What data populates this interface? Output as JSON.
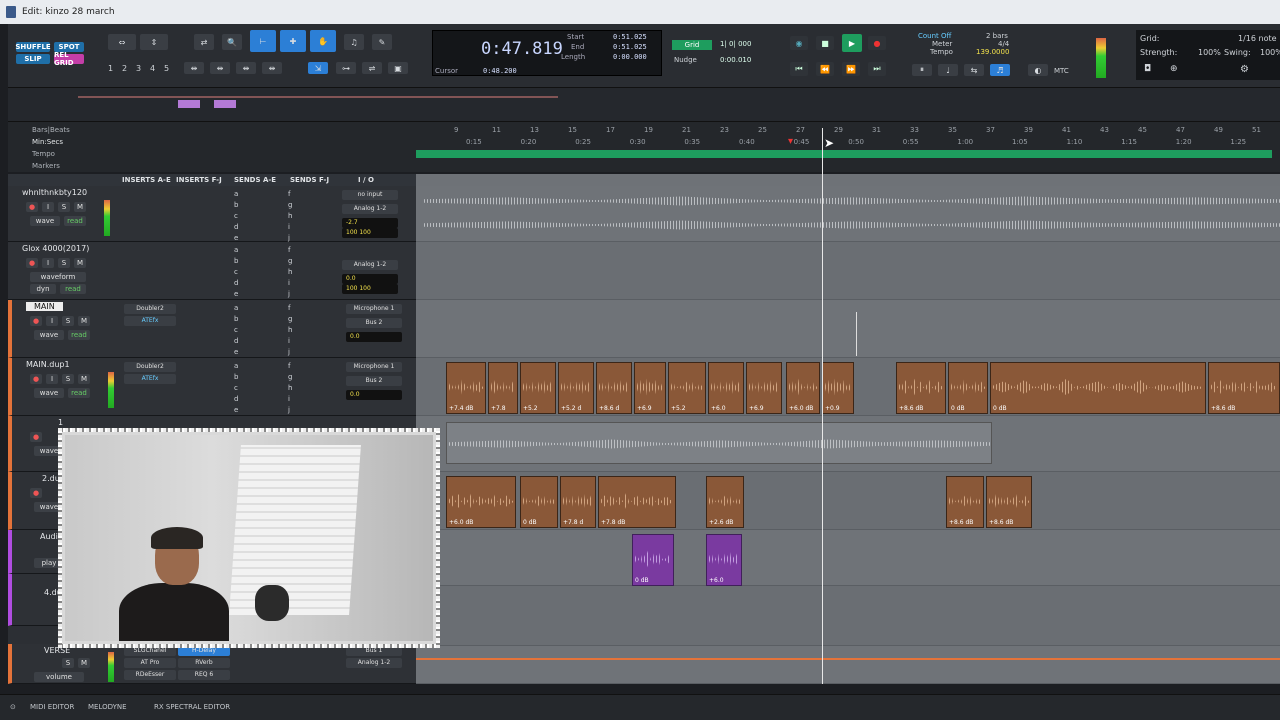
{
  "window": {
    "title": "Edit: kinzo 28 march"
  },
  "modes": {
    "shuffle": "SHUFFLE",
    "spot": "SPOT",
    "slip": "SLIP",
    "grid": "REL GRID"
  },
  "zoom_presets": [
    "1",
    "2",
    "3",
    "4",
    "5"
  ],
  "counter": {
    "main": "0:47.819",
    "start_label": "Start",
    "start": "0:51.025",
    "end_label": "End",
    "end": "0:51.025",
    "length_label": "Length",
    "length": "0:00.000",
    "cursor_label": "Cursor",
    "cursor": "0:48.200"
  },
  "grid_nudge": {
    "grid_btn": "Grid",
    "grid_value": "1| 0| 000",
    "nudge_label": "Nudge",
    "nudge_value": "0:00.010"
  },
  "midi": {
    "count_off": "Count Off",
    "bars": "2 bars",
    "meter_label": "Meter",
    "meter": "4/4",
    "tempo_label": "Tempo",
    "tempo": "139.0000",
    "mtc": "MTC"
  },
  "grid_panel": {
    "grid_label": "Grid:",
    "grid_value": "1/16 note",
    "strength_label": "Strength:",
    "strength": "100%",
    "swing_label": "Swing:",
    "swing": "100%"
  },
  "rulers": {
    "bars_beats": "Bars|Beats",
    "min_secs": "Min:Secs",
    "tempo": "Tempo",
    "markers": "Markers"
  },
  "bar_ticks": [
    "9",
    "11",
    "13",
    "15",
    "17",
    "19",
    "21",
    "23",
    "25",
    "27",
    "29",
    "31",
    "33",
    "35",
    "37",
    "39",
    "41",
    "43",
    "45",
    "47",
    "49",
    "51"
  ],
  "time_ticks": [
    "0:15",
    "0:20",
    "0:25",
    "0:30",
    "0:35",
    "0:40",
    "0:45",
    "0:50",
    "0:55",
    "1:00",
    "1:05",
    "1:10",
    "1:15",
    "1:20",
    "1:25"
  ],
  "mix_header": {
    "inserts_ae": "INSERTS A-E",
    "inserts_fj": "INSERTS F-J",
    "sends_ae": "SENDS A-E",
    "sends_fj": "SENDS F-J",
    "io": "I / O"
  },
  "tracks": [
    {
      "name": "whnlthnkbty120",
      "mode": "wave",
      "auto": "read",
      "input": "no input",
      "output": "Analog 1-2",
      "vol": "-2.7",
      "pan": "100  100"
    },
    {
      "name": "Glox 4000(2017)",
      "mode": "waveform",
      "auto": "read",
      "dyn": "dyn",
      "output": "Analog 1-2",
      "vol": "0.0",
      "pan": "100  100"
    },
    {
      "name": "MAIN",
      "mode": "wave",
      "auto": "read",
      "insert1": "Doubler2",
      "insert2": "ATEfx",
      "input": "Microphone 1",
      "output": "Bus 2",
      "vol": "0.0"
    },
    {
      "name": "MAIN.dup1",
      "mode": "wave",
      "auto": "read",
      "insert1": "Doubler2",
      "insert2": "ATEfx",
      "input": "Microphone 1",
      "output": "Bus 2",
      "vol": "0.0"
    },
    {
      "name": "1",
      "mode": "wave"
    },
    {
      "name": "2.dup",
      "mode": "wave"
    },
    {
      "name": "Audio",
      "mode": "play"
    },
    {
      "name": "4.dup",
      "mode": ""
    },
    {
      "name": "VERSE",
      "mode": "volume",
      "insert1": "SLGChanel",
      "insert2": "AT Pro",
      "insert3": "RDeEsser",
      "insert_f": "H-Delay",
      "insert_g": "RVerb",
      "insert_h": "REQ 6",
      "input": "Bus 1",
      "output": "Analog 1-2"
    }
  ],
  "send_letters_ae": [
    "a",
    "b",
    "c",
    "d",
    "e"
  ],
  "send_letters_fj": [
    "f",
    "g",
    "h",
    "i",
    "j"
  ],
  "clips": {
    "main_dup1": [
      "+7.4 dB",
      "+7.8",
      "+5.2",
      "+5.2 d",
      "+8.6 d",
      "+6.9",
      "+5.2",
      "+6.0",
      "+6.9",
      "+6.0 dB",
      "+0.9",
      "+8.6 dB",
      "0 dB",
      "0 dB",
      "+8.6 dB"
    ],
    "track2": [
      "+6.0 dB",
      "0 dB",
      "+7.8 d",
      "+7.8 dB",
      "+2.6 dB",
      "+8.6 dB",
      "+8.6 dB"
    ],
    "audio": [
      "0 dB",
      "+6.0"
    ]
  },
  "bottom": {
    "midi_editor": "MIDI EDITOR",
    "melodyne": "MELODYNE",
    "rx": "RX SPECTRAL EDITOR"
  },
  "colors": {
    "tempo_bar": "#1e9d5e",
    "clip": "#8a5838",
    "clip_purple": "#7a3aa0",
    "selected_tool": "#2c7fd6"
  }
}
